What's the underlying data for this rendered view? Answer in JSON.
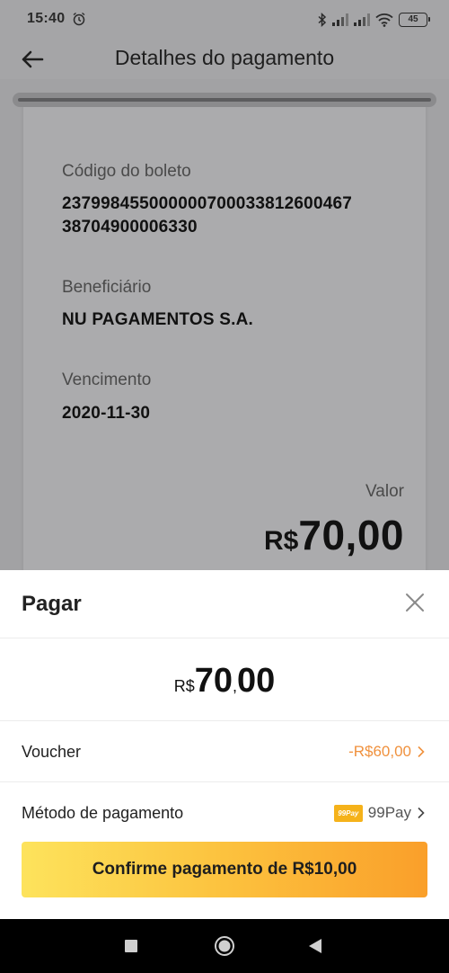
{
  "status_bar": {
    "time": "15:40",
    "battery": "45",
    "icons": [
      "alarm-icon",
      "bluetooth-icon",
      "signal-icon",
      "signal-icon",
      "wifi-icon",
      "battery-icon"
    ]
  },
  "header": {
    "title": "Detalhes do pagamento",
    "back_icon": "arrow-left-icon"
  },
  "boleto": {
    "code_label": "Código do boleto",
    "code_line1": "23799845500000070003381260046​7",
    "code_line2": "38704900006330",
    "beneficiary_label": "Beneficiário",
    "beneficiary_value": "NU PAGAMENTOS S.A.",
    "due_label": "Vencimento",
    "due_value": "2020-11-30",
    "amount_label": "Valor",
    "amount_currency": "R$",
    "amount_value": "70,00"
  },
  "sheet": {
    "title": "Pagar",
    "amount_currency": "R$",
    "amount_int": "70",
    "amount_sep": ",",
    "amount_dec": "00",
    "voucher_label": "Voucher",
    "voucher_value": "-R$60,00",
    "method_label": "Método de pagamento",
    "method_badge": "99Pay",
    "method_value": "99Pay",
    "confirm_label": "Confirme pagamento de R$10,00"
  },
  "colors": {
    "accent_orange": "#f0913d",
    "button_gradient_start": "#fde35c",
    "button_gradient_end": "#fa9f2a",
    "badge": "#f5b21a"
  }
}
